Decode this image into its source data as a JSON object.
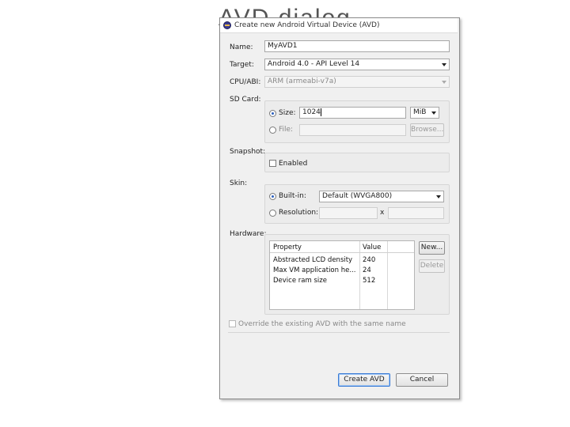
{
  "background_title": "AVD dialog",
  "window": {
    "title": "Create new Android Virtual Device (AVD)"
  },
  "labels": {
    "name": "Name:",
    "target": "Target:",
    "cpu": "CPU/ABI:",
    "sdcard": "SD Card:",
    "snapshot": "Snapshot:",
    "skin": "Skin:",
    "hardware": "Hardware:"
  },
  "name_value": "MyAVD1",
  "target_value": "Android 4.0 - API Level 14",
  "cpu_value": "ARM (armeabi-v7a)",
  "sdcard": {
    "size_label": "Size:",
    "size_value": "1024",
    "unit_value": "MiB",
    "file_label": "File:",
    "browse_label": "Browse..."
  },
  "snapshot": {
    "enabled_label": "Enabled",
    "checked": false
  },
  "skin": {
    "builtin_label": "Built-in:",
    "builtin_value": "Default (WVGA800)",
    "resolution_label": "Resolution:",
    "x_label": "x"
  },
  "hardware": {
    "columns": [
      "Property",
      "Value"
    ],
    "rows": [
      {
        "property": "Abstracted LCD density",
        "value": "240"
      },
      {
        "property": "Max VM application he...",
        "value": "24"
      },
      {
        "property": "Device ram size",
        "value": "512"
      }
    ],
    "new_label": "New...",
    "delete_label": "Delete"
  },
  "override_label": "Override the existing AVD with the same name",
  "buttons": {
    "create": "Create AVD",
    "cancel": "Cancel"
  }
}
